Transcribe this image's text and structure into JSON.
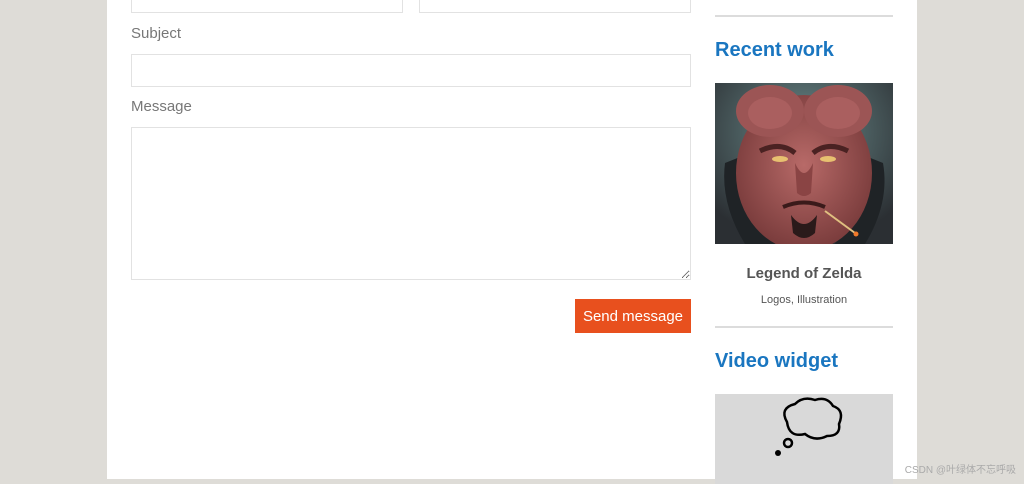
{
  "form": {
    "subject_label": "Subject",
    "subject_value": "",
    "message_label": "Message",
    "message_value": "",
    "send_label": "Send message"
  },
  "sidebar": {
    "recent_work_title": "Recent work",
    "recent_work_item": {
      "title": "Legend of Zelda",
      "tags": "Logos, Illustration"
    },
    "video_widget_title": "Video widget"
  },
  "watermark": "CSDN @叶绿体不忘呼吸",
  "colors": {
    "accent_blue": "#1a76c0",
    "button_orange": "#e8501e",
    "page_background": "#dedcd7"
  }
}
